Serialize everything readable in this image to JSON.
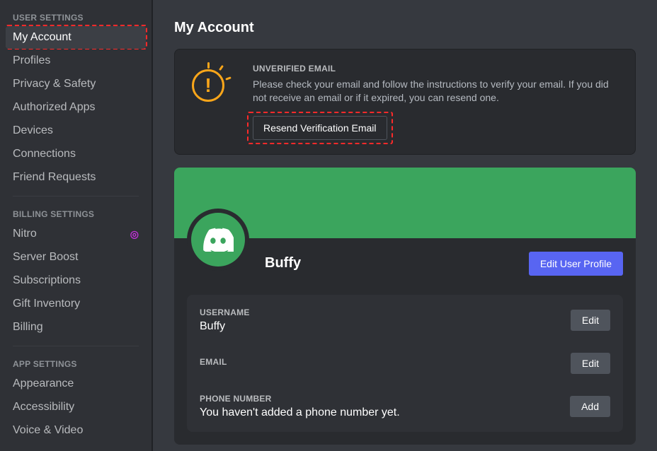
{
  "sidebar": {
    "sections": [
      {
        "header": "User Settings",
        "items": [
          {
            "label": "My Account",
            "selected": true,
            "name": "sidebar-item-my-account"
          },
          {
            "label": "Profiles",
            "selected": false,
            "name": "sidebar-item-profiles"
          },
          {
            "label": "Privacy & Safety",
            "selected": false,
            "name": "sidebar-item-privacy-safety"
          },
          {
            "label": "Authorized Apps",
            "selected": false,
            "name": "sidebar-item-authorized-apps"
          },
          {
            "label": "Devices",
            "selected": false,
            "name": "sidebar-item-devices"
          },
          {
            "label": "Connections",
            "selected": false,
            "name": "sidebar-item-connections"
          },
          {
            "label": "Friend Requests",
            "selected": false,
            "name": "sidebar-item-friend-requests"
          }
        ]
      },
      {
        "header": "Billing Settings",
        "items": [
          {
            "label": "Nitro",
            "selected": false,
            "badge": "◎",
            "name": "sidebar-item-nitro"
          },
          {
            "label": "Server Boost",
            "selected": false,
            "name": "sidebar-item-server-boost"
          },
          {
            "label": "Subscriptions",
            "selected": false,
            "name": "sidebar-item-subscriptions"
          },
          {
            "label": "Gift Inventory",
            "selected": false,
            "name": "sidebar-item-gift-inventory"
          },
          {
            "label": "Billing",
            "selected": false,
            "name": "sidebar-item-billing"
          }
        ]
      },
      {
        "header": "App Settings",
        "items": [
          {
            "label": "Appearance",
            "selected": false,
            "name": "sidebar-item-appearance"
          },
          {
            "label": "Accessibility",
            "selected": false,
            "name": "sidebar-item-accessibility"
          },
          {
            "label": "Voice & Video",
            "selected": false,
            "name": "sidebar-item-voice-video"
          }
        ]
      }
    ]
  },
  "page": {
    "title": "My Account"
  },
  "verify": {
    "header": "Unverified Email",
    "body": "Please check your email and follow the instructions to verify your email. If you did not receive an email or if it expired, you can resend one.",
    "resend_label": "Resend Verification Email"
  },
  "account": {
    "banner_color": "#3ba55d",
    "display_name": "Buffy",
    "edit_profile_label": "Edit User Profile",
    "fields": {
      "username": {
        "label": "Username",
        "value": "Buffy",
        "action": "Edit"
      },
      "email": {
        "label": "Email",
        "value": "",
        "action": "Edit"
      },
      "phone": {
        "label": "Phone Number",
        "value": "You haven't added a phone number yet.",
        "action": "Add"
      }
    }
  }
}
